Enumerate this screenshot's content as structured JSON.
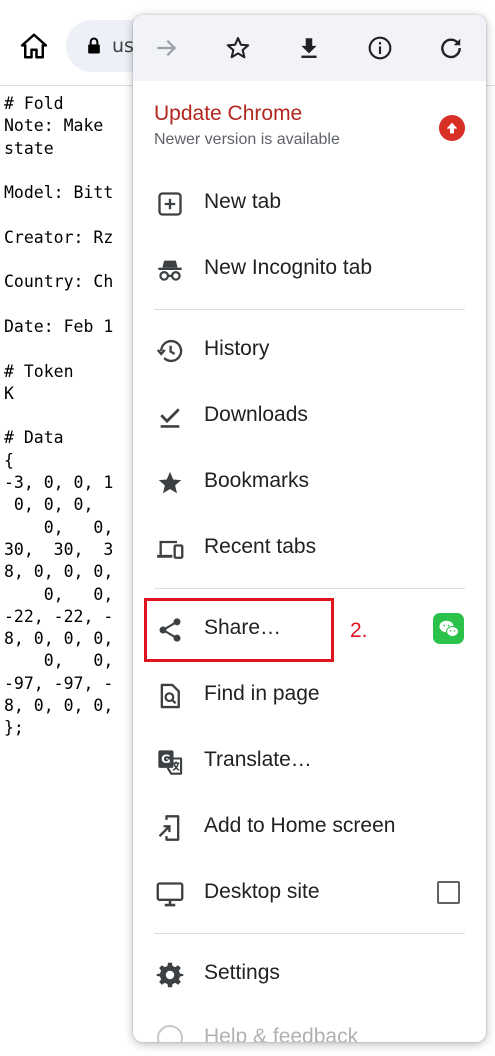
{
  "browser": {
    "url_partial": "us"
  },
  "page_text": [
    "# Fold",
    "Note: Make ",
    "state",
    "",
    "Model: Bitt",
    "",
    "Creator: Rz",
    "",
    "Country: Ch",
    "",
    "Date: Feb 1",
    "",
    "# Token",
    "K",
    "",
    "# Data",
    "{",
    "-3, 0, 0, 1",
    " 0, 0, 0, ",
    "    0,   0,",
    "30,  30,  3",
    "8, 0, 0, 0,",
    "    0,   0,",
    "-22, -22, -",
    "8, 0, 0, 0,",
    "    0,   0,",
    "-97, -97, -",
    "8, 0, 0, 0,",
    "};"
  ],
  "menu": {
    "toolbar": [
      {
        "name": "forward-icon",
        "enabled": false
      },
      {
        "name": "star-icon",
        "enabled": true
      },
      {
        "name": "download-icon",
        "enabled": true
      },
      {
        "name": "info-icon",
        "enabled": true
      },
      {
        "name": "refresh-icon",
        "enabled": true
      }
    ],
    "update": {
      "title": "Update Chrome",
      "subtitle": "Newer version is available"
    },
    "items": {
      "new_tab": "New tab",
      "new_incognito_tab": "New Incognito tab",
      "history": "History",
      "downloads": "Downloads",
      "bookmarks": "Bookmarks",
      "recent_tabs": "Recent tabs",
      "share": "Share…",
      "find_in_page": "Find in page",
      "translate": "Translate…",
      "add_to_home": "Add to Home screen",
      "desktop_site": "Desktop site",
      "settings": "Settings",
      "help_feedback": "Help & feedback"
    },
    "desktop_site_checked": false
  },
  "annotation": {
    "step_label": "2."
  },
  "colors": {
    "update_red": "#b3261e",
    "annotation_red": "#e0141e",
    "wechat_green": "#2bc24b",
    "icon_gray": "#3c4043"
  }
}
